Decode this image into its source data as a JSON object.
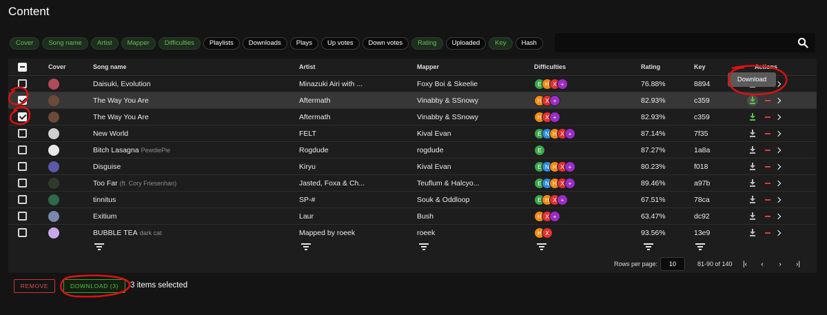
{
  "page": {
    "title": "Content"
  },
  "chips": [
    {
      "label": "Cover",
      "active": true
    },
    {
      "label": "Song name",
      "active": true
    },
    {
      "label": "Artist",
      "active": true
    },
    {
      "label": "Mapper",
      "active": true
    },
    {
      "label": "Difficulties",
      "active": true
    },
    {
      "label": "Playlists",
      "active": false
    },
    {
      "label": "Downloads",
      "active": false
    },
    {
      "label": "Plays",
      "active": false
    },
    {
      "label": "Up votes",
      "active": false
    },
    {
      "label": "Down votes",
      "active": false
    },
    {
      "label": "Rating",
      "active": true
    },
    {
      "label": "Uploaded",
      "active": false
    },
    {
      "label": "Key",
      "active": true
    },
    {
      "label": "Hash",
      "active": false
    }
  ],
  "table": {
    "headers": {
      "cover": "Cover",
      "song": "Song name",
      "artist": "Artist",
      "mapper": "Mapper",
      "difficulties": "Difficulties",
      "rating": "Rating",
      "key": "Key",
      "actions": "Actions"
    },
    "rows": [
      {
        "checked": false,
        "selected": false,
        "cover_color": "#b04a5a",
        "song": "Daisuki, Evolution",
        "sub": "",
        "artist": "Minazuki Airi with ...",
        "mapper": "Foxy Boi & Skeelie",
        "diffs": [
          "E",
          "H",
          "X",
          "+"
        ],
        "rating": "76.88%",
        "key": "8894",
        "dl_green": false,
        "dl_hover": false
      },
      {
        "checked": true,
        "selected": true,
        "cover_color": "#6b4a3a",
        "song": "The Way You Are",
        "sub": "",
        "artist": "Aftermath",
        "mapper": "Vinabby & SSnowy",
        "diffs": [
          "H",
          "X",
          "+"
        ],
        "rating": "82.93%",
        "key": "c359",
        "dl_green": true,
        "dl_hover": true
      },
      {
        "checked": true,
        "selected": false,
        "cover_color": "#6b4a3a",
        "song": "The Way You Are",
        "sub": "",
        "artist": "Aftermath",
        "mapper": "Vinabby & SSnowy",
        "diffs": [
          "H",
          "X",
          "+"
        ],
        "rating": "82.93%",
        "key": "c359",
        "dl_green": true,
        "dl_hover": false
      },
      {
        "checked": false,
        "selected": false,
        "cover_color": "#cfcfcf",
        "song": "New World",
        "sub": "",
        "artist": "FELT",
        "mapper": "Kival Evan",
        "diffs": [
          "E",
          "N",
          "H",
          "X",
          "+"
        ],
        "rating": "87.14%",
        "key": "7f35",
        "dl_green": false,
        "dl_hover": false
      },
      {
        "checked": false,
        "selected": false,
        "cover_color": "#e8e8e8",
        "song": "Bitch Lasagna",
        "sub": "PewdiePie",
        "artist": "Rogdude",
        "mapper": "rogdude",
        "diffs": [
          "E"
        ],
        "rating": "87.27%",
        "key": "1a8a",
        "dl_green": false,
        "dl_hover": false
      },
      {
        "checked": false,
        "selected": false,
        "cover_color": "#5a5aa8",
        "song": "Disguise",
        "sub": "",
        "artist": "Kiryu",
        "mapper": "Kival Evan",
        "diffs": [
          "E",
          "N",
          "H",
          "X",
          "+"
        ],
        "rating": "80.23%",
        "key": "f018",
        "dl_green": false,
        "dl_hover": false
      },
      {
        "checked": false,
        "selected": false,
        "cover_color": "#2e3a2a",
        "song": "Too Far",
        "sub": "(ft. Cory Friesenhan)",
        "artist": "Jasted, Foxa & Ch...",
        "mapper": "Teuflum & Halcyo...",
        "diffs": [
          "E",
          "N",
          "H",
          "X",
          "+"
        ],
        "rating": "89.46%",
        "key": "a97b",
        "dl_green": false,
        "dl_hover": false
      },
      {
        "checked": false,
        "selected": false,
        "cover_color": "#2e6a4a",
        "song": "tinnitus",
        "sub": "",
        "artist": "SP-#",
        "mapper": "Souk & Oddloop",
        "diffs": [
          "E",
          "H",
          "X",
          "+"
        ],
        "rating": "67.51%",
        "key": "78ca",
        "dl_green": false,
        "dl_hover": false
      },
      {
        "checked": false,
        "selected": false,
        "cover_color": "#7a86b0",
        "song": "Exitium",
        "sub": "",
        "artist": "Laur",
        "mapper": "Bush",
        "diffs": [
          "H",
          "X",
          "+"
        ],
        "rating": "63.47%",
        "key": "dc92",
        "dl_green": false,
        "dl_hover": false
      },
      {
        "checked": false,
        "selected": false,
        "cover_color": "#c8a8e8",
        "song": "BUBBLE TEA",
        "sub": "dark cat",
        "artist": "Mapped by roeek",
        "mapper": "roeek",
        "diffs": [
          "H",
          "X"
        ],
        "rating": "93.56%",
        "key": "13e9",
        "dl_green": false,
        "dl_hover": false
      }
    ]
  },
  "tooltip": {
    "text": "Download"
  },
  "pagination": {
    "rows_per_page_label": "Rows per page:",
    "rows_per_page": "10",
    "range": "81-90 of 140"
  },
  "footer": {
    "remove_label": "REMOVE",
    "download_label": "DOWNLOAD (3)",
    "selected_text": "3 items selected"
  },
  "colors": {
    "annotation": "#e01010",
    "chip_active": "#70b85e"
  }
}
